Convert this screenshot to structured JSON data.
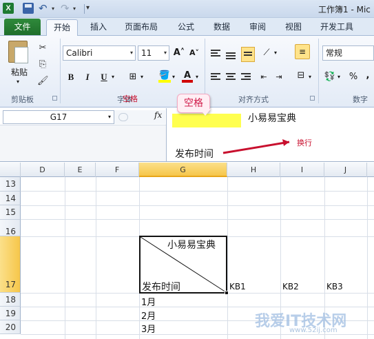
{
  "title_bar": {
    "window_title": "工作簿1 - Mic"
  },
  "ribbon_tabs": [
    "文件",
    "开始",
    "插入",
    "页面布局",
    "公式",
    "数据",
    "审阅",
    "视图",
    "开发工具"
  ],
  "ribbon": {
    "paste_label": "粘贴",
    "font_name": "Calibri",
    "font_size": "11",
    "bold": "B",
    "italic": "I",
    "underline": "U",
    "number_format": "常规",
    "percent": "%",
    "comma": ",",
    "groups": {
      "clipboard": "剪贴板",
      "font": "字体",
      "alignment": "对齐方式",
      "number": "数字"
    }
  },
  "name_box": {
    "value": "G17"
  },
  "formula_bar": {
    "fx": "fx",
    "line1": "小易易宝典",
    "line2": "发布时间"
  },
  "annotations": {
    "space_callout": "空格",
    "space_overlay": "空格",
    "newline": "换行"
  },
  "columns": [
    "D",
    "E",
    "F",
    "G",
    "H",
    "I",
    "J"
  ],
  "rows": [
    "13",
    "14",
    "15",
    "16",
    "17",
    "18",
    "19",
    "20"
  ],
  "cells": {
    "G17_top": "小易易宝典",
    "G17_bottom": "发布时间",
    "H17": "KB1",
    "I17": "KB2",
    "J17": "KB3",
    "G18": "1月",
    "G19": "2月",
    "G20": "3月"
  },
  "watermark": {
    "text": "我爱IT技术网",
    "url": "www.52ij.com"
  },
  "colors": {
    "file_tab": "#1f6e2b",
    "active_header": "#f6c64a",
    "callout_text": "#d01c4a",
    "arrow": "#c8102e",
    "yellow_fill": "#ffff4f"
  }
}
